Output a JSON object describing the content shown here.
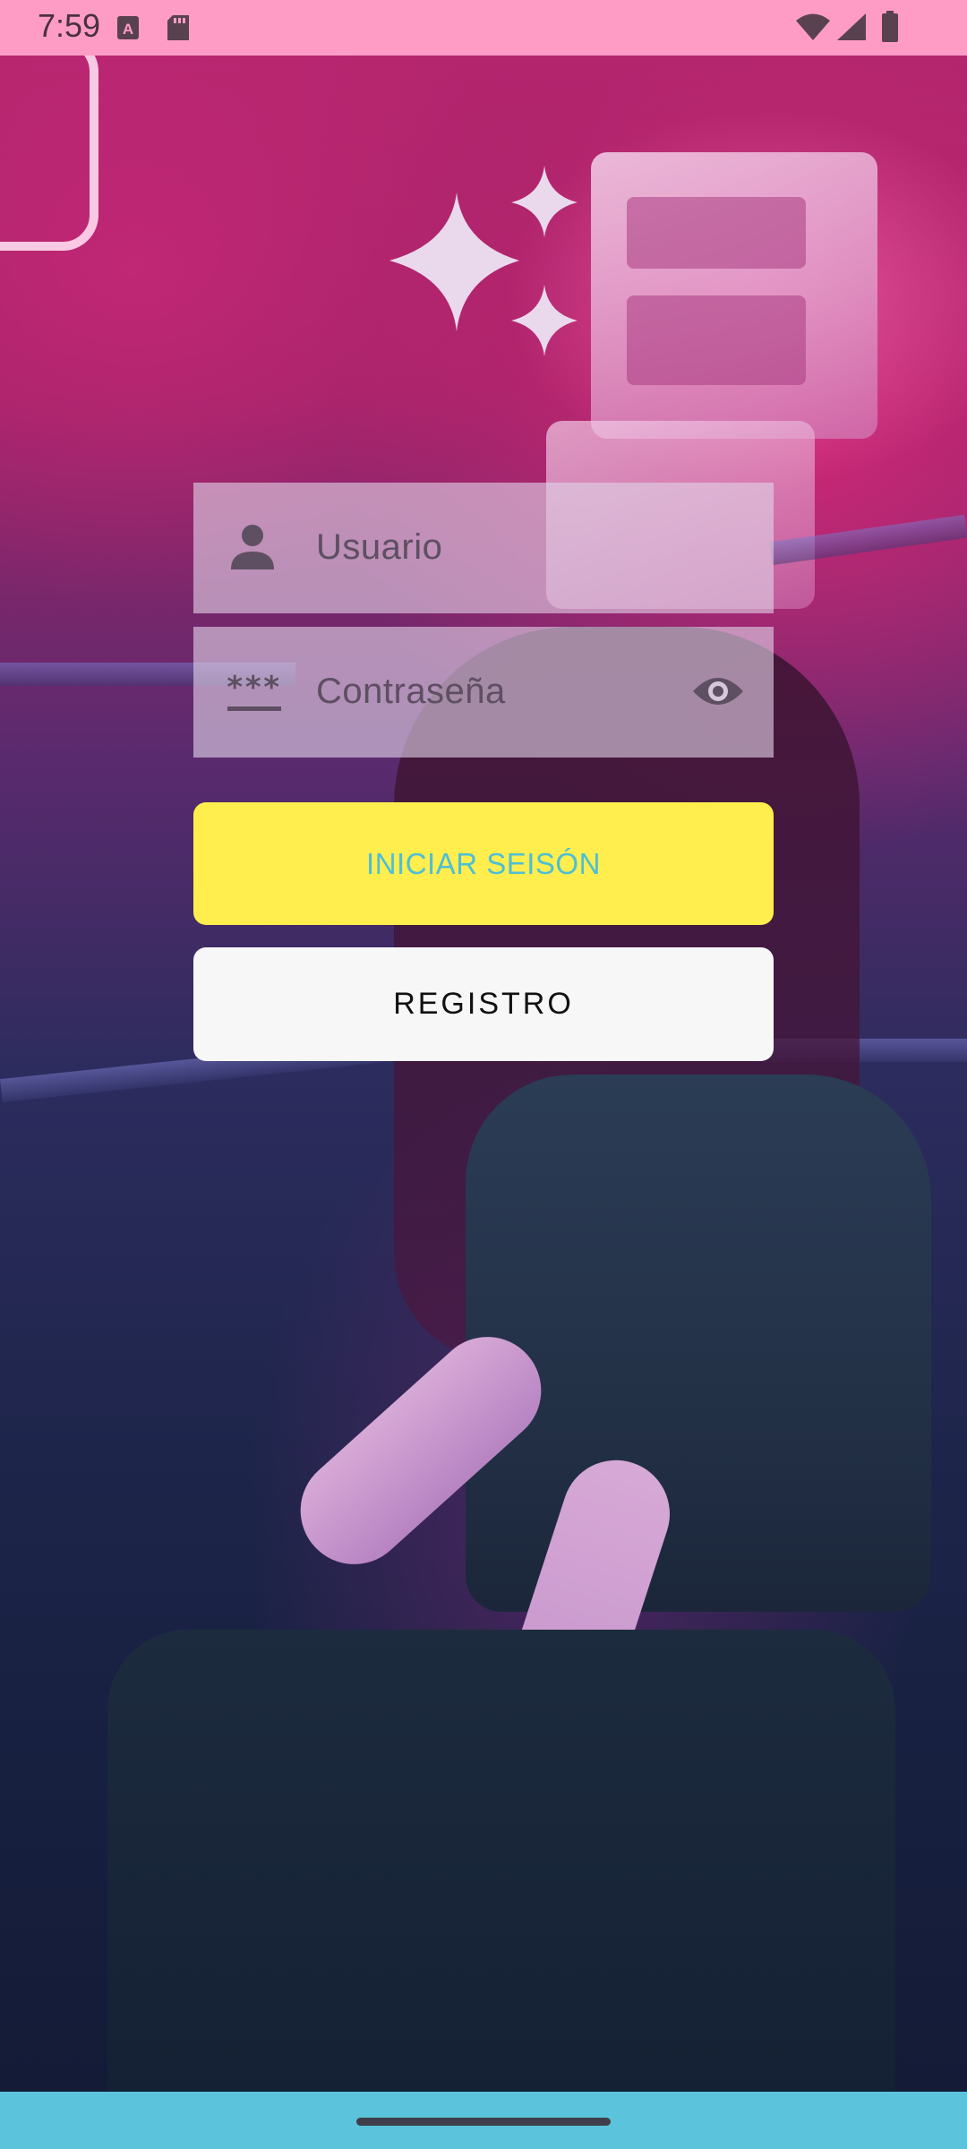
{
  "status_bar": {
    "time": "7:59",
    "icons": [
      "text-notification-icon",
      "sd-card-icon",
      "wifi-icon",
      "cellular-signal-icon",
      "battery-icon"
    ],
    "background_color": "#ff9cc6"
  },
  "logo": {
    "icon": "sparkles-icon"
  },
  "login_form": {
    "username": {
      "placeholder": "Usuario",
      "icon": "person-icon"
    },
    "password": {
      "placeholder": "Contraseña",
      "icon": "password-icon",
      "toggle_icon": "eye-icon"
    }
  },
  "buttons": {
    "login_label": "INICIAR SEISÓN",
    "login_color": "#ffee4d",
    "login_text_color": "#4dbfd6",
    "register_label": "REGISTRO"
  },
  "nav_bar": {
    "background_color": "#5bc4dc"
  }
}
